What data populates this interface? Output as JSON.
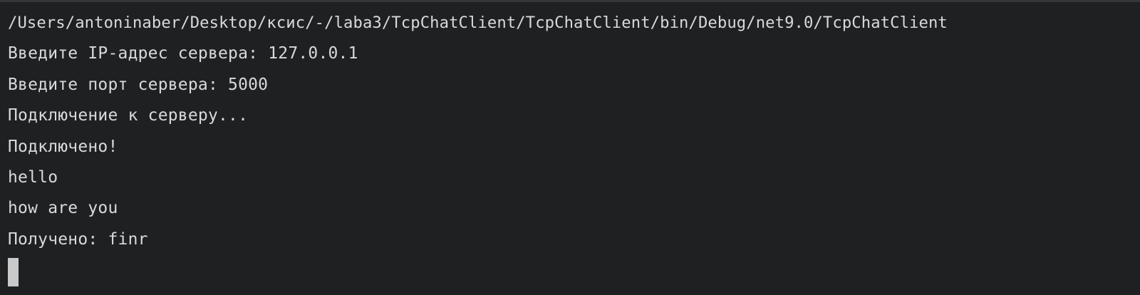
{
  "terminal": {
    "path": "/Users/antoninaber/Desktop/ксис/-/laba3/TcpChatClient/TcpChatClient/bin/Debug/net9.0/TcpChatClient",
    "lines": [
      "Введите IP-адрес сервера: 127.0.0.1",
      "Введите порт сервера: 5000",
      "Подключение к серверу...",
      "Подключено!",
      "hello",
      "how are you",
      "Получено: finr"
    ]
  }
}
